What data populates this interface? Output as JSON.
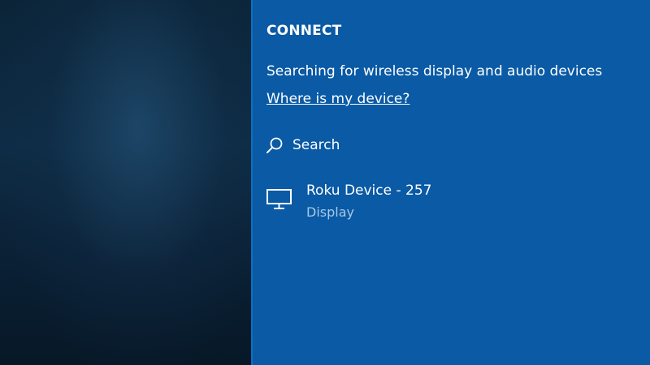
{
  "panel": {
    "title": "CONNECT",
    "status_text": "Searching for wireless display and audio devices",
    "help_link": "Where is my device?",
    "search": {
      "label": "Search",
      "icon": "search-icon"
    },
    "devices": [
      {
        "name": "Roku Device - 257",
        "type": "Display",
        "icon": "monitor-icon"
      }
    ]
  },
  "colors": {
    "panel_background": "#0a5aa5",
    "text": "#ffffff",
    "secondary_text": "#a9c8e8",
    "desktop_background": "#0b2438"
  }
}
